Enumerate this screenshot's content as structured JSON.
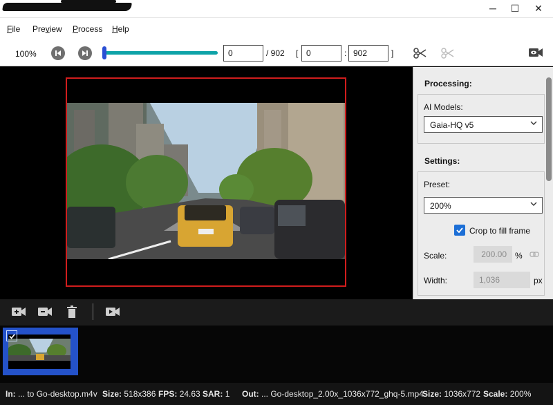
{
  "window": {
    "minimize_glyph": "─",
    "maximize_glyph": "☐",
    "close_glyph": "✕"
  },
  "menu": [
    "File",
    "Preview",
    "Process",
    "Help"
  ],
  "menu_underline": [
    "F",
    "v",
    "P",
    "H"
  ],
  "toolbar": {
    "zoom": "100%",
    "current_frame": "0",
    "total_frames": "/ 902",
    "bracket_open": "[",
    "range_start": "0",
    "range_sep": ":",
    "range_end": "902",
    "bracket_close": "]",
    "slider_position": 0.0
  },
  "panel": {
    "processing_title": "Processing:",
    "ai_models_label": "AI Models:",
    "ai_model_value": "Gaia-HQ v5",
    "settings_title": "Settings:",
    "preset_label": "Preset:",
    "preset_value": "200%",
    "crop_label": "Crop to fill frame",
    "crop_checked": true,
    "scale_label": "Scale:",
    "scale_value": "200.00",
    "scale_unit": "%",
    "width_label": "Width:",
    "width_value": "1,036",
    "width_unit": "px"
  },
  "status": {
    "in_label": "In:",
    "in_value": "... to Go-desktop.m4v",
    "size_label": "Size:",
    "size_value": "518x386",
    "fps_label": "FPS:",
    "fps_value": "24.63",
    "sar_label": "SAR:",
    "sar_value": "1",
    "out_label": "Out:",
    "out_value": "... Go-desktop_2.00x_1036x772_ghq-5.mp4",
    "out_size_label": "Size:",
    "out_size_value": "1036x772",
    "scale_label": "Scale:",
    "scale_value": "200%"
  },
  "colors": {
    "accent": "#2452c9",
    "frame_border": "#d11d1d",
    "slider": "#0ea3a8",
    "checkbox": "#1d6fd6"
  }
}
